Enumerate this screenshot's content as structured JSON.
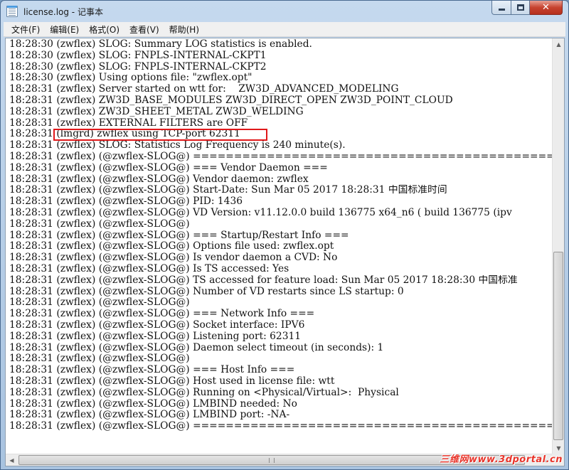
{
  "window": {
    "title": "license.log - 记事本",
    "minimize_icon": "minimize-icon",
    "maximize_icon": "maximize-icon",
    "close_icon": "close-icon"
  },
  "menu": {
    "items": [
      {
        "label": "文件(F)"
      },
      {
        "label": "编辑(E)"
      },
      {
        "label": "格式(O)"
      },
      {
        "label": "查看(V)"
      },
      {
        "label": "帮助(H)"
      }
    ]
  },
  "log": {
    "lines": [
      "18:28:30 (zwflex) SLOG: Summary LOG statistics is enabled.",
      "18:28:30 (zwflex) SLOG: FNPLS-INTERNAL-CKPT1",
      "18:28:30 (zwflex) SLOG: FNPLS-INTERNAL-CKPT2",
      "18:28:30 (zwflex) Using options file: \"zwflex.opt\"",
      "18:28:31 (zwflex) Server started on wtt for:    ZW3D_ADVANCED_MODELING",
      "18:28:31 (zwflex) ZW3D_BASE_MODULES ZW3D_DIRECT_OPEN ZW3D_POINT_CLOUD",
      "18:28:31 (zwflex) ZW3D_SHEET_METAL ZW3D_WELDING",
      "18:28:31 (zwflex) EXTERNAL FILTERS are OFF",
      "18:28:31 (lmgrd) zwflex using TCP-port 62311",
      "18:28:31 (zwflex) SLOG: Statistics Log Frequency is 240 minute(s).",
      "18:28:31 (zwflex) (@zwflex-SLOG@) ===============================================",
      "18:28:31 (zwflex) (@zwflex-SLOG@) === Vendor Daemon ===",
      "18:28:31 (zwflex) (@zwflex-SLOG@) Vendor daemon: zwflex",
      "18:28:31 (zwflex) (@zwflex-SLOG@) Start-Date: Sun Mar 05 2017 18:28:31 中国标准时间",
      "18:28:31 (zwflex) (@zwflex-SLOG@) PID: 1436",
      "18:28:31 (zwflex) (@zwflex-SLOG@) VD Version: v11.12.0.0 build 136775 x64_n6 ( build 136775 (ipv",
      "18:28:31 (zwflex) (@zwflex-SLOG@)",
      "18:28:31 (zwflex) (@zwflex-SLOG@) === Startup/Restart Info ===",
      "18:28:31 (zwflex) (@zwflex-SLOG@) Options file used: zwflex.opt",
      "18:28:31 (zwflex) (@zwflex-SLOG@) Is vendor daemon a CVD: No",
      "18:28:31 (zwflex) (@zwflex-SLOG@) Is TS accessed: Yes",
      "18:28:31 (zwflex) (@zwflex-SLOG@) TS accessed for feature load: Sun Mar 05 2017 18:28:30 中国标准",
      "18:28:31 (zwflex) (@zwflex-SLOG@) Number of VD restarts since LS startup: 0",
      "18:28:31 (zwflex) (@zwflex-SLOG@)",
      "18:28:31 (zwflex) (@zwflex-SLOG@) === Network Info ===",
      "18:28:31 (zwflex) (@zwflex-SLOG@) Socket interface: IPV6",
      "18:28:31 (zwflex) (@zwflex-SLOG@) Listening port: 62311",
      "18:28:31 (zwflex) (@zwflex-SLOG@) Daemon select timeout (in seconds): 1",
      "18:28:31 (zwflex) (@zwflex-SLOG@)",
      "18:28:31 (zwflex) (@zwflex-SLOG@) === Host Info ===",
      "18:28:31 (zwflex) (@zwflex-SLOG@) Host used in license file: wtt",
      "18:28:31 (zwflex) (@zwflex-SLOG@) Running on <Physical/Virtual>:  Physical",
      "18:28:31 (zwflex) (@zwflex-SLOG@) LMBIND needed: No",
      "18:28:31 (zwflex) (@zwflex-SLOG@) LMBIND port: -NA-",
      "18:28:31 (zwflex) (@zwflex-SLOG@) ==============================================="
    ],
    "highlight_color": "#e0181a"
  },
  "watermark": {
    "text": "三维网www.3dportal.cn",
    "color": "#e8342a"
  }
}
